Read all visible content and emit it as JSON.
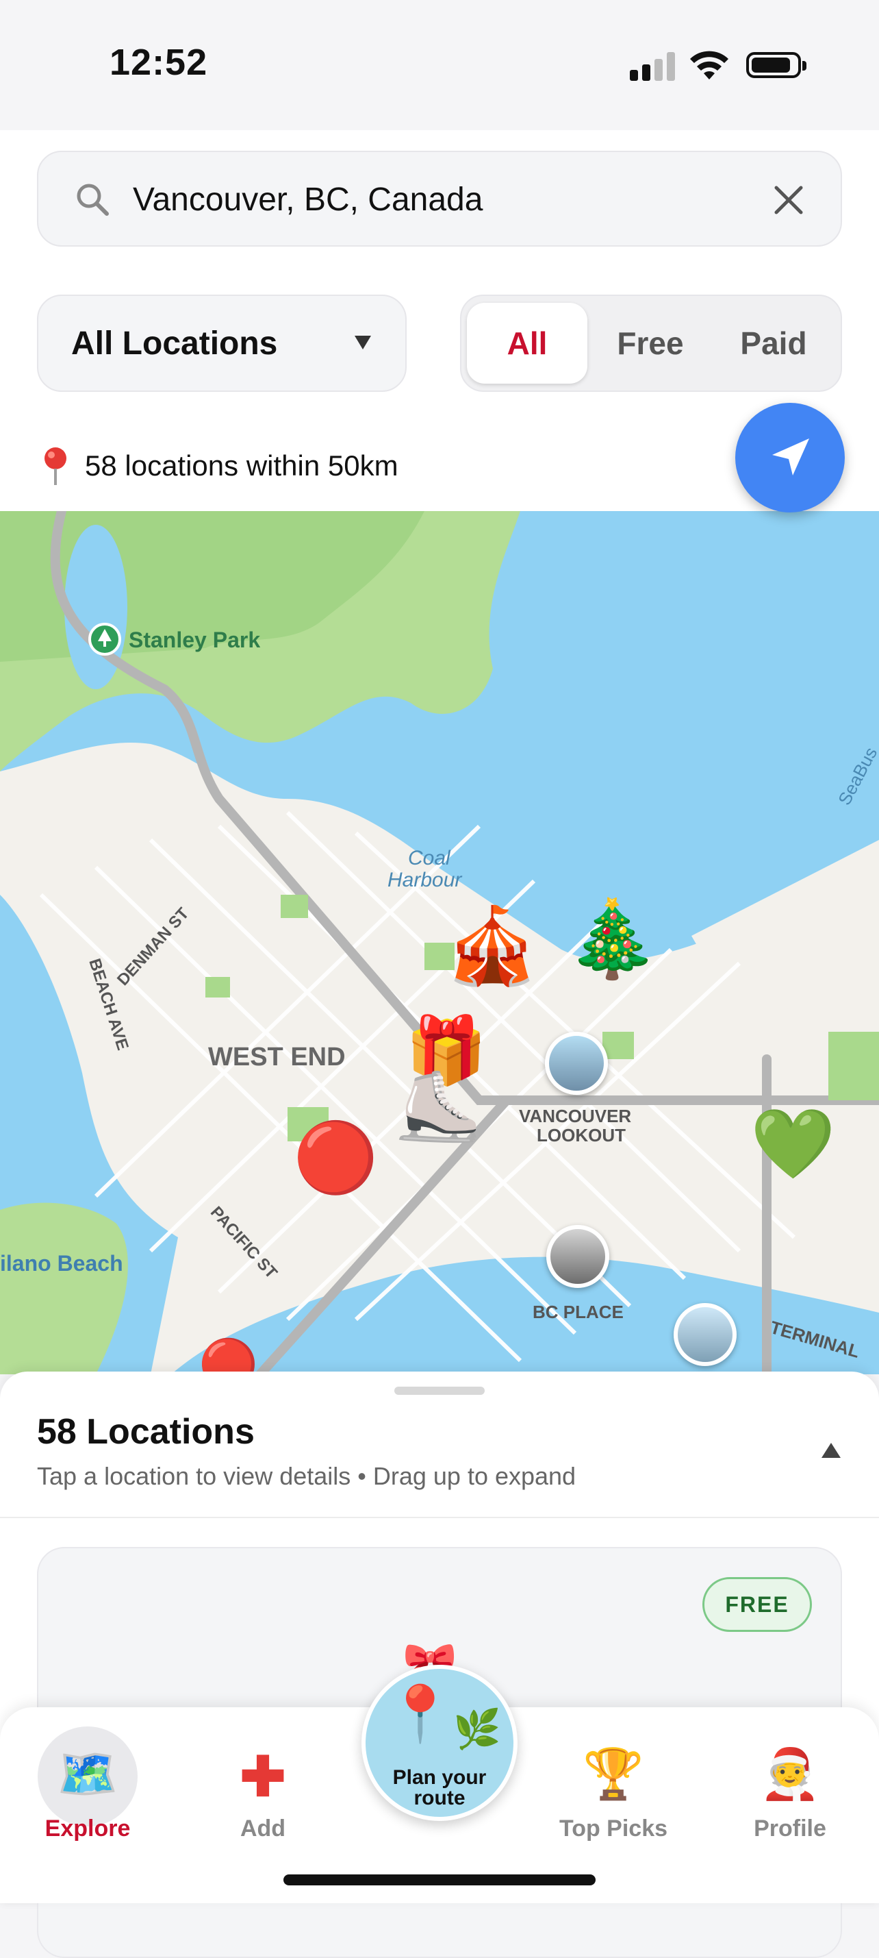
{
  "status_bar": {
    "time": "12:52"
  },
  "search": {
    "value": "Vancouver, BC, Canada"
  },
  "filters": {
    "location_dropdown": "All Locations",
    "segments": [
      "All",
      "Free",
      "Paid"
    ],
    "active_segment": "All"
  },
  "results": {
    "summary": "58 locations within 50km"
  },
  "map": {
    "labels": {
      "stanley_park": "Stanley Park",
      "coal_harbour_1": "Coal",
      "coal_harbour_2": "Harbour",
      "denman": "DENMAN ST",
      "beach_ave": "BEACH AVE",
      "west_end": "WEST END",
      "vancouver_lookout_1": "VANCOUVER",
      "vancouver_lookout_2": "LOOKOUT",
      "pacific_st": "PACIFIC ST",
      "kitsilano": "ilano Beach",
      "bc_place": "BC PLACE",
      "terminal": "TERMINAL",
      "seabus": "SeaBus"
    }
  },
  "sheet": {
    "title": "58 Locations",
    "subtitle": "Tap a location to view details • Drag up to expand",
    "card_badge": "FREE"
  },
  "tabbar": {
    "explore": "Explore",
    "add": "Add",
    "plan_line1": "Plan your",
    "plan_line2": "route",
    "top_picks": "Top Picks",
    "profile": "Profile"
  },
  "colors": {
    "accent": "#c8102e",
    "locate": "#4285f4",
    "water": "#8fd1f3",
    "park": "#a9d98c"
  }
}
